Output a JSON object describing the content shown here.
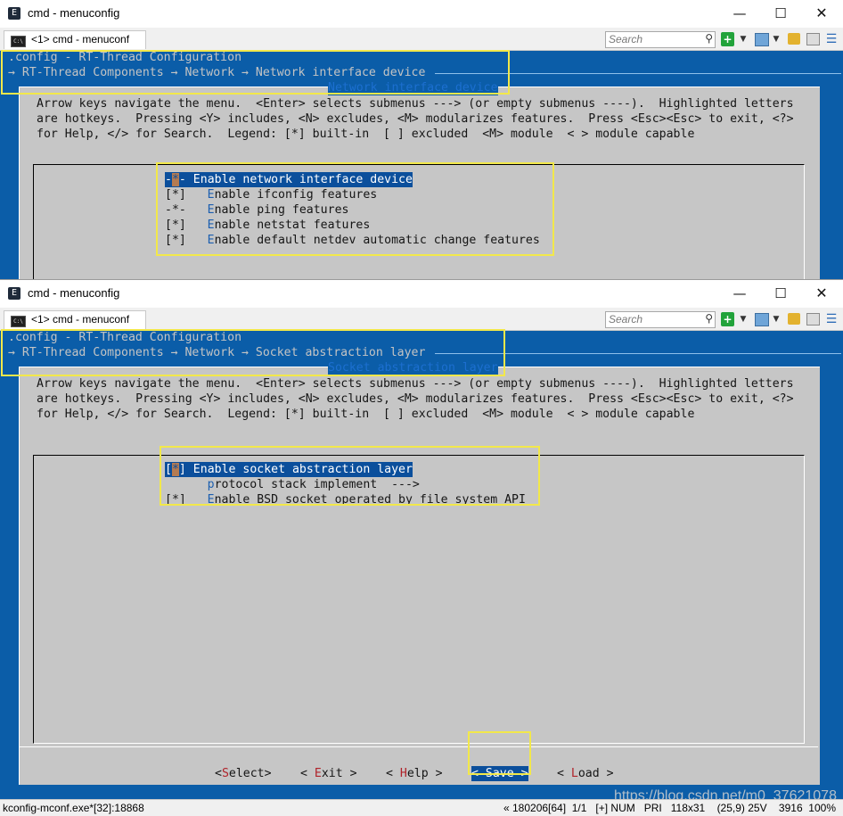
{
  "window1": {
    "title": "cmd - menuconfig",
    "app_icon": "E",
    "tab_label": "<1> cmd - menuconf",
    "search_placeholder": "Search",
    "breadcrumb_line1": ".config - RT-Thread Configuration",
    "breadcrumb_line2": "→ RT-Thread Components → Network → Network interface device",
    "dialog_title": "Network interface device",
    "help_lines": [
      "Arrow keys navigate the menu.  <Enter> selects submenus ---> (or empty submenus ----).  Highlighted letters",
      "are hotkeys.  Pressing <Y> includes, <N> excludes, <M> modularizes features.  Press <Esc><Esc> to exit, <?>",
      "for Help, </> for Search.  Legend: [*] built-in  [ ] excluded  <M> module  < > module capable"
    ],
    "items": [
      {
        "prefix_a": "-",
        "cursor": "*",
        "prefix_b": "- ",
        "hotkey": "E",
        "rest": "nable network interface device",
        "selected": true
      },
      {
        "prefix": "[*]   ",
        "hotkey": "E",
        "rest": "nable ifconfig features"
      },
      {
        "prefix": "-*-   ",
        "hotkey": "E",
        "rest": "nable ping features"
      },
      {
        "prefix": "[*]   ",
        "hotkey": "E",
        "rest": "nable netstat features"
      },
      {
        "prefix": "[*]   ",
        "hotkey": "E",
        "rest": "nable default netdev automatic change features"
      }
    ]
  },
  "window2": {
    "title": "cmd - menuconfig",
    "app_icon": "E",
    "tab_label": "<1> cmd - menuconf",
    "search_placeholder": "Search",
    "breadcrumb_line1": ".config - RT-Thread Configuration",
    "breadcrumb_line2": "→ RT-Thread Components → Network → Socket abstraction layer",
    "dialog_title": "Socket abstraction layer",
    "help_lines": [
      "Arrow keys navigate the menu.  <Enter> selects submenus ---> (or empty submenus ----).  Highlighted letters",
      "are hotkeys.  Pressing <Y> includes, <N> excludes, <M> modularizes features.  Press <Esc><Esc> to exit, <?>",
      "for Help, </> for Search.  Legend: [*] built-in  [ ] excluded  <M> module  < > module capable"
    ],
    "items": [
      {
        "prefix_a": "[",
        "cursor": "*",
        "prefix_b": "] ",
        "hotkey": "E",
        "rest": "nable socket abstraction layer",
        "selected": true
      },
      {
        "prefix": "      ",
        "hotkey": "p",
        "rest": "rotocol stack implement  --->"
      },
      {
        "prefix": "[*]   ",
        "hotkey": "E",
        "rest": "nable BSD socket operated by file system API"
      }
    ],
    "buttons": [
      {
        "pre": "<",
        "hotkey": "S",
        "post": "elect>",
        "selected": false
      },
      {
        "pre": "< ",
        "hotkey": "E",
        "post": "xit >",
        "selected": false
      },
      {
        "pre": "< ",
        "hotkey": "H",
        "post": "elp >",
        "selected": false
      },
      {
        "pre": "< ",
        "hotkey": "S",
        "post": "ave >",
        "selected": true
      },
      {
        "pre": "< ",
        "hotkey": "L",
        "post": "oad >",
        "selected": false
      }
    ]
  },
  "statusbar": {
    "left": "kconfig-mconf.exe*[32]:18868",
    "right": "« 180206[64]  1/1   [+] NUM   PRI   118x31    (25,9) 25V    3916  100%"
  },
  "watermark": "https://blog.csdn.net/m0_37621078",
  "colors": {
    "console_bg": "#0b5da8",
    "dialog_bg": "#c6c6c6",
    "selection_bg": "#0b4f9c",
    "highlight_box": "#f2e84a"
  },
  "icons": [
    "app-e-icon",
    "minimize-icon",
    "maximize-icon",
    "close-icon",
    "console-tab-icon",
    "search-icon",
    "add-console-icon",
    "dropdown-icon",
    "panel-icon",
    "lock-icon",
    "document-icon",
    "hamburger-menu-icon"
  ]
}
